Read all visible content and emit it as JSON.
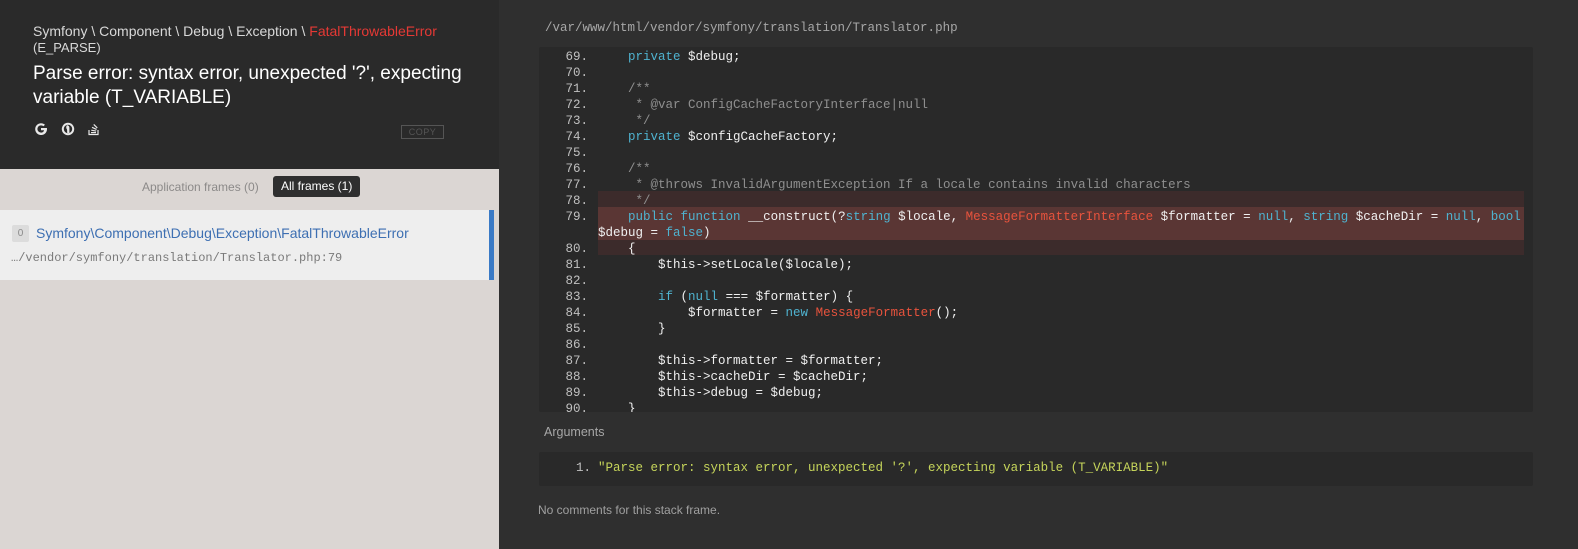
{
  "header": {
    "breadcrumb": "Symfony \\ Component \\ Debug \\ Exception \\ ",
    "exception_class": "FatalThrowableError",
    "subtype": "(E_PARSE)",
    "message": "Parse error: syntax error, unexpected '?', expecting variable (T_VARIABLE)",
    "icons": [
      "google-icon",
      "duckduckgo-icon",
      "stackoverflow-icon"
    ],
    "copy_label": "COPY"
  },
  "frame_filter": {
    "app_frames_label": "Application frames (0)",
    "all_frames_label": "All frames (1)"
  },
  "frames": [
    {
      "index": "0",
      "class": "Symfony\\Component\\Debug\\Exception\\FatalThrowableError",
      "file": "…/vendor/symfony/translation/Translator.php:79"
    }
  ],
  "code": {
    "file_path": "/var/www/html/vendor/symfony/translation/Translator.php",
    "highlight_line": "79.",
    "lines": [
      {
        "n": "69.",
        "text": "    private $debug;"
      },
      {
        "n": "70.",
        "text": ""
      },
      {
        "n": "71.",
        "text": "    /**"
      },
      {
        "n": "72.",
        "text": "     * @var ConfigCacheFactoryInterface|null"
      },
      {
        "n": "73.",
        "text": "     */"
      },
      {
        "n": "74.",
        "text": "    private $configCacheFactory;"
      },
      {
        "n": "75.",
        "text": ""
      },
      {
        "n": "76.",
        "text": "    /**"
      },
      {
        "n": "77.",
        "text": "     * @throws InvalidArgumentException If a locale contains invalid characters"
      },
      {
        "n": "78.",
        "text": "     */"
      },
      {
        "n": "79.",
        "text": "    public function __construct(?string $locale, MessageFormatterInterface $formatter = null, string $cacheDir = null, bool",
        "cont": "$debug = false)"
      },
      {
        "n": "80.",
        "text": "    {"
      },
      {
        "n": "81.",
        "text": "        $this->setLocale($locale);"
      },
      {
        "n": "82.",
        "text": ""
      },
      {
        "n": "83.",
        "text": "        if (null === $formatter) {"
      },
      {
        "n": "84.",
        "text": "            $formatter = new MessageFormatter();"
      },
      {
        "n": "85.",
        "text": "        }"
      },
      {
        "n": "86.",
        "text": ""
      },
      {
        "n": "87.",
        "text": "        $this->formatter = $formatter;"
      },
      {
        "n": "88.",
        "text": "        $this->cacheDir = $cacheDir;"
      },
      {
        "n": "89.",
        "text": "        $this->debug = $debug;"
      },
      {
        "n": "90.",
        "text": "    }"
      }
    ]
  },
  "arguments": {
    "title": "Arguments",
    "items": [
      {
        "n": "1.",
        "value": "\"Parse error: syntax error, unexpected '?', expecting variable (T_VARIABLE)\""
      }
    ]
  },
  "comments": {
    "empty_text": "No comments for this stack frame."
  },
  "colors": {
    "accent_red": "#e53935",
    "link_blue": "#3d6fb2",
    "keyword": "#4fb3d0",
    "type": "#e8533d",
    "string": "#c5d45a",
    "selected_marker": "#3a7ac6"
  }
}
